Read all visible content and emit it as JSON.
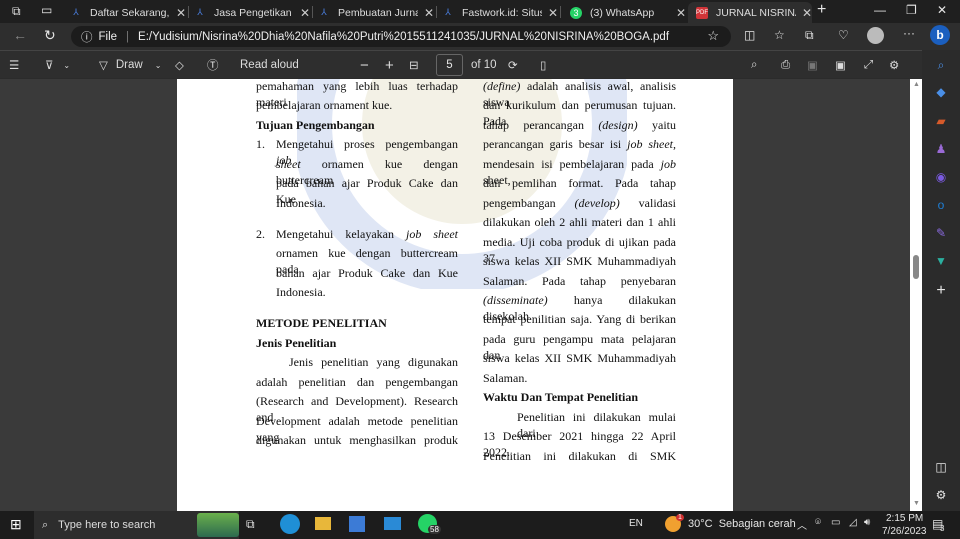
{
  "tabs": [
    {
      "label": "Daftar Sekarang, Mul",
      "icon": "freelancer-icon"
    },
    {
      "label": "Jasa Pengetikan Onlir",
      "icon": "freelancer-icon"
    },
    {
      "label": "Pembuatan Jurnal &",
      "icon": "freelancer-icon"
    },
    {
      "label": "Fastwork.id: Situs Fre",
      "icon": "freelancer-icon"
    },
    {
      "label": "(3) WhatsApp",
      "icon": "whatsapp-icon",
      "badge": "3"
    },
    {
      "label": "JURNAL NISRINA BO",
      "icon": "pdf-icon"
    }
  ],
  "address": {
    "scheme": "File",
    "url": "E:/Yudisium/Nisrina%20Dhia%20Nafila%20Putri%2015511241035/JURNAL%20NISRINA%20BOGA.pdf"
  },
  "pdf_toolbar": {
    "draw": "Draw",
    "read_aloud": "Read aloud",
    "page": "5",
    "of": "of 10"
  },
  "colors": {
    "accent": "#0078d4",
    "page": "#ffffff",
    "chrome": "#2e2e2e"
  },
  "doc": {
    "left": [
      [
        {
          "t": "pemahaman yang lebih luas terhadap materi"
        }
      ],
      [
        {
          "t": "pembelajaran ornament kue."
        }
      ],
      [
        {
          "t": "Tujuan Pengembangan",
          "s": "b"
        }
      ],
      [
        {
          "t": "Mengetahui proses pengembangan "
        },
        {
          "t": "job",
          "s": "i"
        }
      ],
      [
        {
          "t": "sheet",
          "s": "i"
        },
        {
          "t": " ornamen kue dengan buttercream"
        }
      ],
      [
        {
          "t": "pada bahan ajar Produk Cake dan Kue"
        }
      ],
      [
        {
          "t": "Indonesia."
        }
      ],
      [
        {
          "t": "Mengetahui kelayakan "
        },
        {
          "t": "job sheet",
          "s": "i"
        }
      ],
      [
        {
          "t": "ornamen kue dengan buttercream pada"
        }
      ],
      [
        {
          "t": "bahan ajar Produk Cake dan Kue"
        }
      ],
      [
        {
          "t": "Indonesia."
        }
      ],
      [
        {
          "t": "METODE PENELITIAN",
          "s": "b"
        }
      ],
      [
        {
          "t": "Jenis Penelitian",
          "s": "b"
        }
      ],
      [
        {
          "t": "Jenis penelitian yang digunakan"
        }
      ],
      [
        {
          "t": "adalah penelitian dan pengembangan"
        }
      ],
      [
        {
          "t": "(Research and Development). Research and"
        }
      ],
      [
        {
          "t": "Development adalah metode penelitian yang"
        }
      ],
      [
        {
          "t": "digunakan untuk menghasilkan produk"
        }
      ]
    ],
    "list_numbers": [
      "1.",
      "2."
    ],
    "right": [
      [
        {
          "t": "(define)",
          "s": "i"
        },
        {
          "t": " adalah analisis awal, analisis siswa"
        }
      ],
      [
        {
          "t": "dan kurikulum dan perumusan tujuan. Pada"
        }
      ],
      [
        {
          "t": "tahap perancangan "
        },
        {
          "t": "(design)",
          "s": "i"
        },
        {
          "t": " yaitu"
        }
      ],
      [
        {
          "t": "perancangan garis besar isi "
        },
        {
          "t": "job sheet,",
          "s": "i"
        }
      ],
      [
        {
          "t": "mendesain isi pembelajaran pada "
        },
        {
          "t": "job",
          "s": "i"
        },
        {
          "t": " sheet,"
        }
      ],
      [
        {
          "t": "dan pemlihan format. Pada tahap"
        }
      ],
      [
        {
          "t": "pengembangan "
        },
        {
          "t": "(develop)",
          "s": "i"
        },
        {
          "t": " validasi"
        }
      ],
      [
        {
          "t": "dilakukan oleh 2 ahli materi dan 1 ahli"
        }
      ],
      [
        {
          "t": "media. Uji coba produk di ujikan pada 37"
        }
      ],
      [
        {
          "t": "siswa kelas XII SMK Muhammadiyah"
        }
      ],
      [
        {
          "t": "Salaman. Pada tahap penyebaran"
        }
      ],
      [
        {
          "t": "(disseminate)",
          "s": "i"
        },
        {
          "t": " hanya dilakukan disekolah"
        }
      ],
      [
        {
          "t": "tempat penilitian saja. Yang di berikan"
        }
      ],
      [
        {
          "t": "pada guru pengampu mata pelajaran dan"
        }
      ],
      [
        {
          "t": "siswa kelas XII SMK Muhammadiyah"
        }
      ],
      [
        {
          "t": "Salaman."
        }
      ],
      [
        {
          "t": "Waktu Dan Tempat Penelitian",
          "s": "b"
        }
      ],
      [
        {
          "t": "Penelitian ini dilakukan mulai dari"
        }
      ],
      [
        {
          "t": "13 Desember 2021 hingga 22 April 2022."
        }
      ],
      [
        {
          "t": "Penelitian ini dilakukan di SMK"
        }
      ]
    ]
  },
  "taskbar": {
    "search_placeholder": "Type here to search",
    "whatsapp_badge": "58",
    "lang": "EN",
    "weather": "30°C  Sebagian cerah",
    "weather_badge": "1",
    "time": "2:15 PM",
    "date": "7/26/2023",
    "notifications": "3"
  }
}
